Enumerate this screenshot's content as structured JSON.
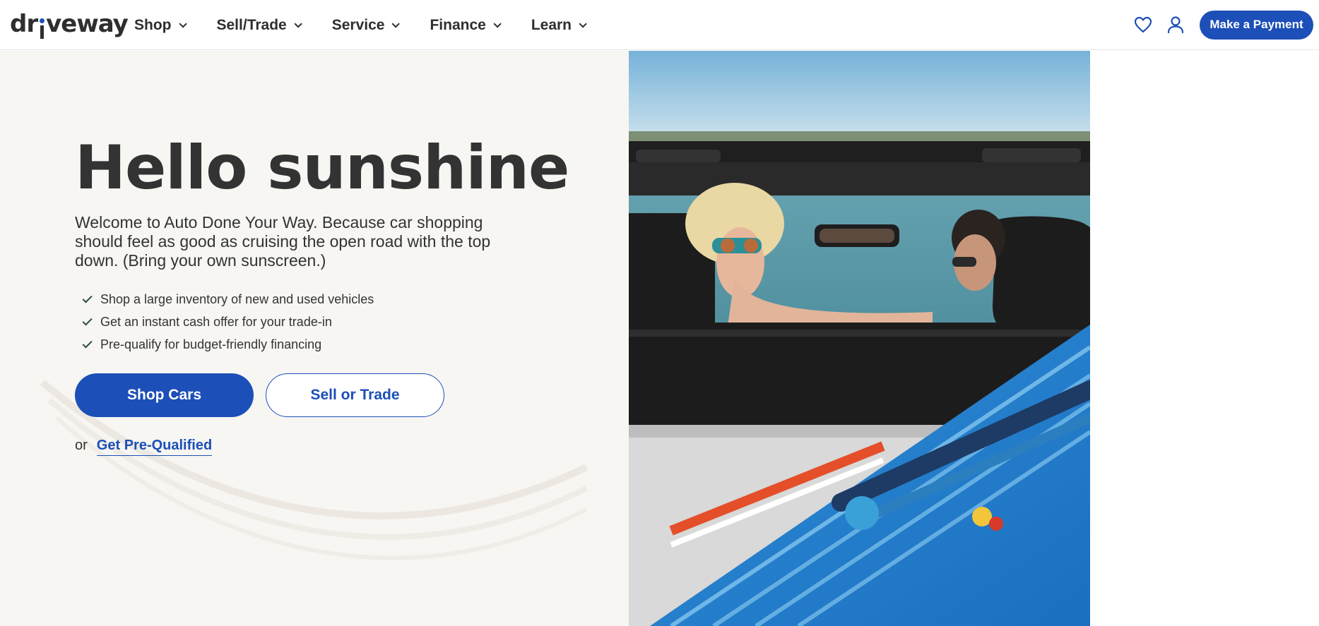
{
  "header": {
    "logo_text_a": "dr",
    "logo_text_b": "veway",
    "nav": [
      {
        "label": "Shop"
      },
      {
        "label": "Sell/Trade"
      },
      {
        "label": "Service"
      },
      {
        "label": "Finance"
      },
      {
        "label": "Learn"
      }
    ],
    "icons": {
      "favorites": "heart-icon",
      "account": "user-icon"
    },
    "payment_button": "Make a Payment"
  },
  "hero": {
    "title": "Hello sunshine",
    "description": "Welcome to Auto Done Your Way. Because car shopping should feel as good as cruising the open road with the top down. (Bring your own sunscreen.)",
    "checklist": [
      "Shop a large inventory of new and used vehicles",
      "Get an instant cash offer for your trade-in",
      "Pre-qualify for budget-friendly financing"
    ],
    "primary_button": "Shop Cars",
    "secondary_button": "Sell or Trade",
    "or_text": "or",
    "prequal_link": "Get Pre-Qualified"
  },
  "colors": {
    "brand_blue": "#1c4fb8",
    "hero_bg": "#f7f6f3",
    "text_dark": "#333333",
    "check_green": "#2d4d46"
  }
}
